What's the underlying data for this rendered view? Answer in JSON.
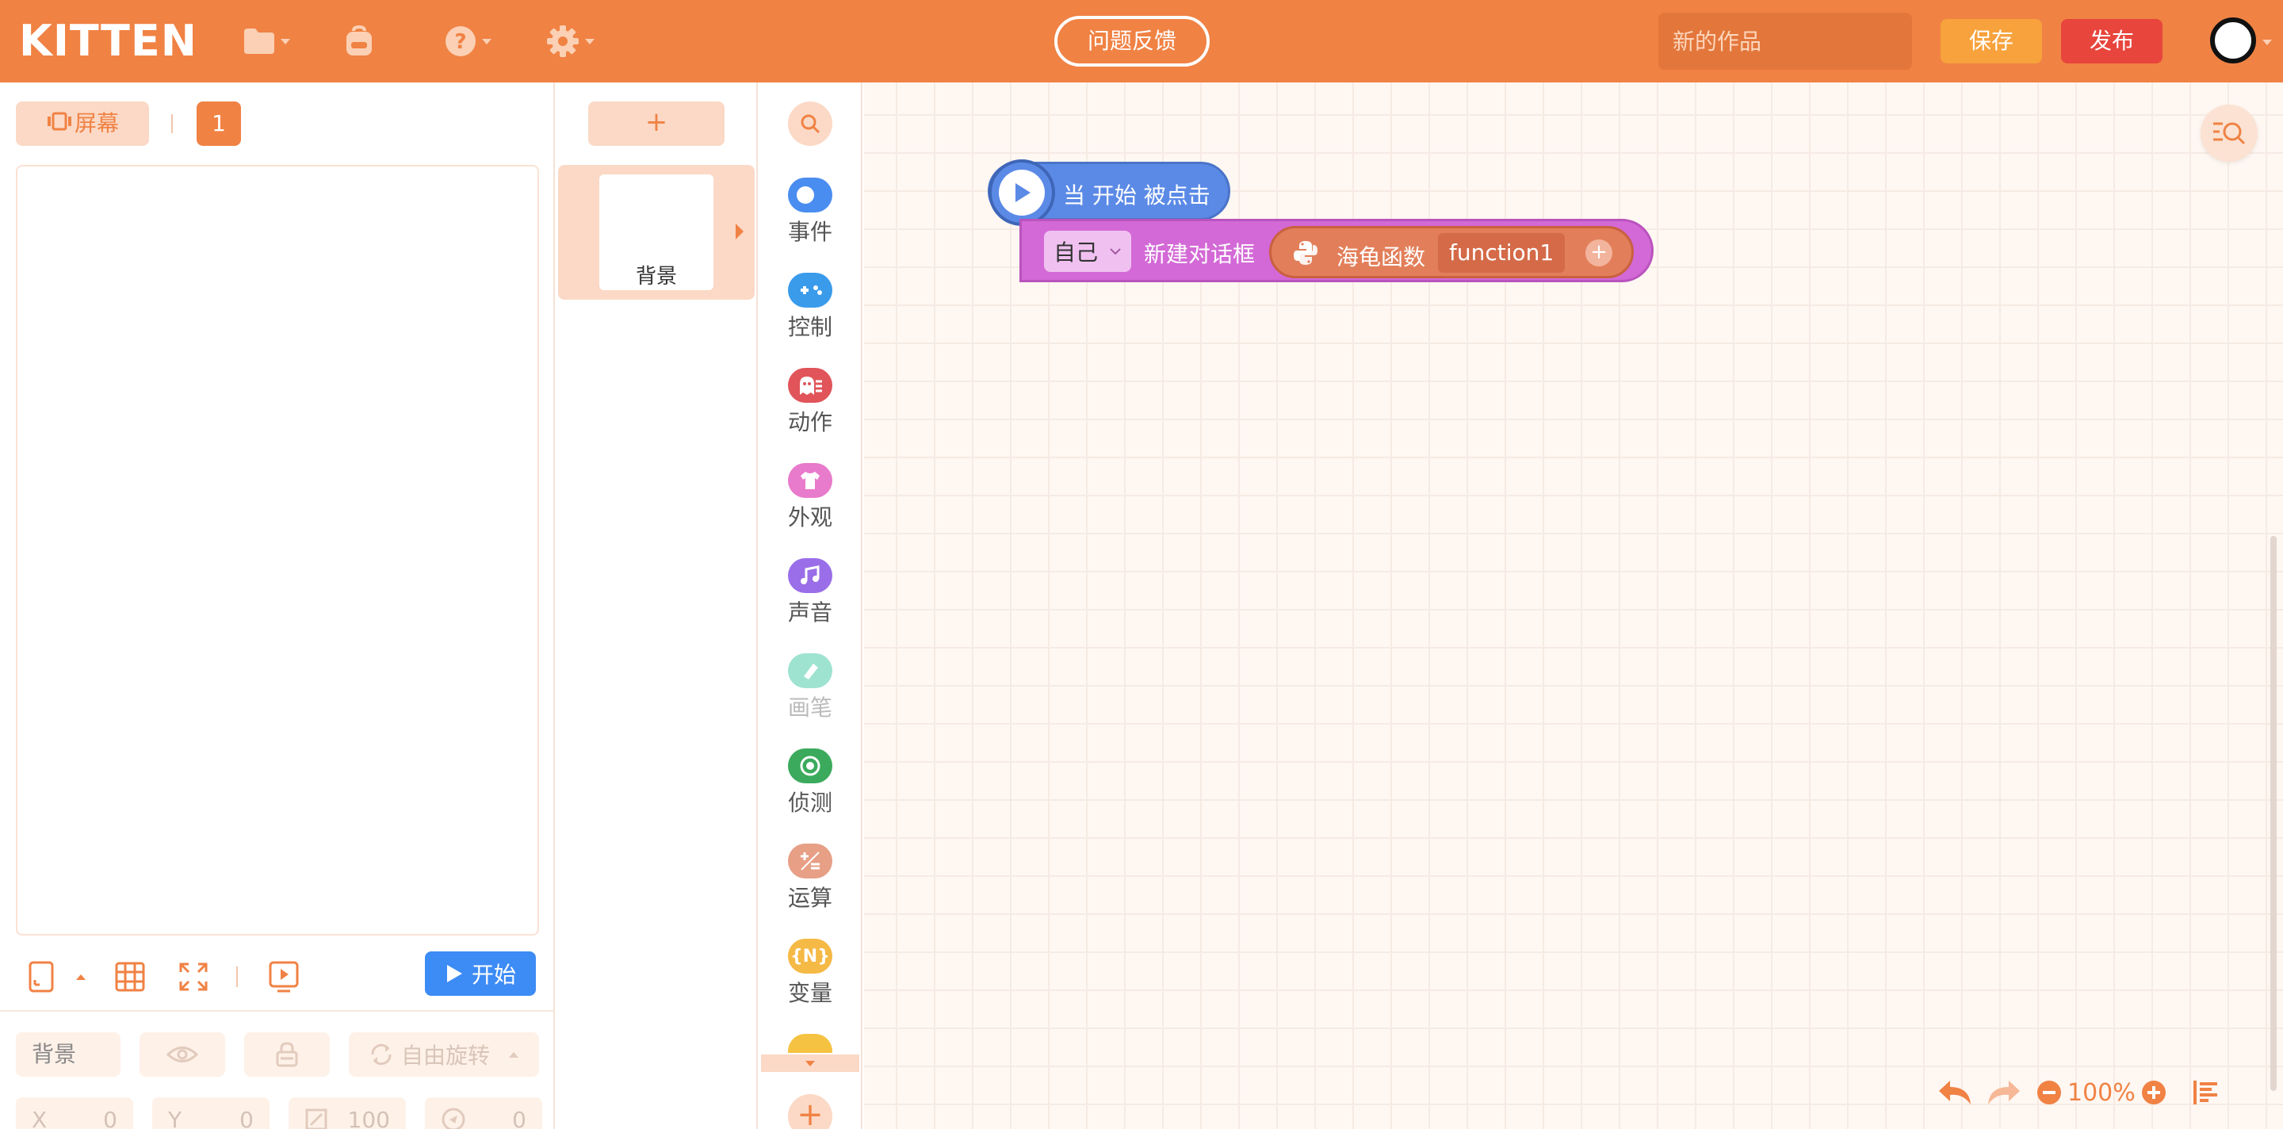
{
  "app": {
    "logo": "KITTEN",
    "feedback_label": "问题反馈",
    "title_placeholder": "新的作品",
    "save_label": "保存",
    "publish_label": "发布"
  },
  "stage_panel": {
    "screen_tab_label": "屏幕",
    "screen_count": "1",
    "start_label": "开始",
    "selected_name": "背景",
    "rotate_label": "自由旋转",
    "coords": {
      "x_label": "X",
      "x_value": "0",
      "y_label": "Y",
      "y_value": "0",
      "size_value": "100",
      "direction_value": "0"
    }
  },
  "sprite_panel": {
    "add_label": "+",
    "items": [
      {
        "label": "背景"
      }
    ]
  },
  "categories": [
    {
      "label": "事件",
      "color": "#4A8DF0",
      "icon": "toggle-icon"
    },
    {
      "label": "控制",
      "color": "#3A9BEB",
      "icon": "gamepad-icon"
    },
    {
      "label": "动作",
      "color": "#E0545A",
      "icon": "ghost-icon"
    },
    {
      "label": "外观",
      "color": "#E87BCB",
      "icon": "shirt-icon"
    },
    {
      "label": "声音",
      "color": "#9A6EE8",
      "icon": "music-icon"
    },
    {
      "label": "画笔",
      "color": "#9EE3D0",
      "icon": "pen-icon"
    },
    {
      "label": "侦测",
      "color": "#3BAA5C",
      "icon": "radar-icon"
    },
    {
      "label": "运算",
      "color": "#E79F86",
      "icon": "math-icon"
    },
    {
      "label": "变量",
      "color": "#F5B945",
      "icon": "variable-icon"
    }
  ],
  "blocks": {
    "hat_text": "当 开始 被点击",
    "self_option": "自己",
    "dialog_text": "新建对话框",
    "turtle_text": "海龟函数",
    "function_name": "function1",
    "add_param": "+"
  },
  "workspace": {
    "zoom_level": "100%"
  },
  "colors": {
    "brand": "#F08244",
    "start_button": "#3D8BF5",
    "publish": "#E8453C",
    "save": "#F7A23C"
  }
}
